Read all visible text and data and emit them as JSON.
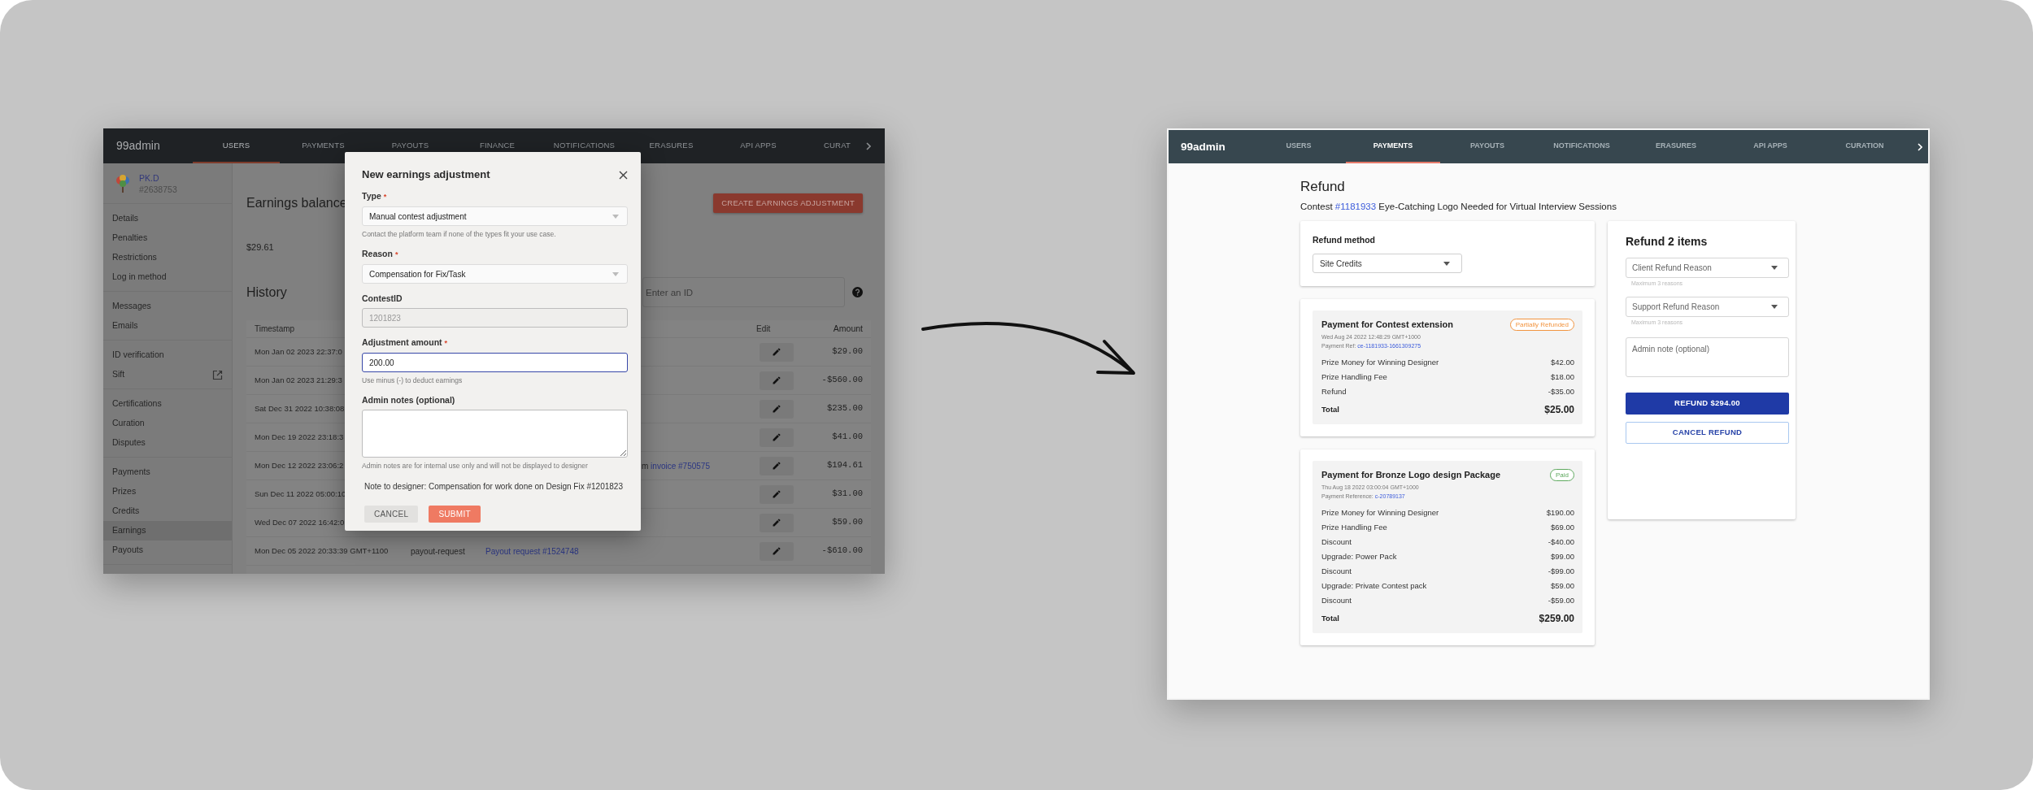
{
  "left_screen": {
    "navbar": {
      "brand": "99admin",
      "tabs": [
        {
          "label": "USERS",
          "selected": true
        },
        {
          "label": "PAYMENTS",
          "selected": false
        },
        {
          "label": "PAYOUTS",
          "selected": false
        },
        {
          "label": "FINANCE",
          "selected": false
        },
        {
          "label": "NOTIFICATIONS",
          "selected": false
        },
        {
          "label": "ERASURES",
          "selected": false
        },
        {
          "label": "API APPS",
          "selected": false
        },
        {
          "label": "CURAT",
          "selected": false
        }
      ]
    },
    "sidebar": {
      "user": {
        "name": "PK.D",
        "id": "#2638753"
      },
      "groups": [
        {
          "items": [
            {
              "label": "Details",
              "selected": false,
              "external": false
            },
            {
              "label": "Penalties",
              "selected": false,
              "external": false
            },
            {
              "label": "Restrictions",
              "selected": false,
              "external": false
            },
            {
              "label": "Log in method",
              "selected": false,
              "external": false
            }
          ]
        },
        {
          "items": [
            {
              "label": "Messages",
              "selected": false,
              "external": false
            },
            {
              "label": "Emails",
              "selected": false,
              "external": false
            }
          ]
        },
        {
          "items": [
            {
              "label": "ID verification",
              "selected": false,
              "external": false
            },
            {
              "label": "Sift",
              "selected": false,
              "external": true
            }
          ]
        },
        {
          "items": [
            {
              "label": "Certifications",
              "selected": false,
              "external": false
            },
            {
              "label": "Curation",
              "selected": false,
              "external": false
            },
            {
              "label": "Disputes",
              "selected": false,
              "external": false
            }
          ]
        },
        {
          "items": [
            {
              "label": "Payments",
              "selected": false,
              "external": false
            },
            {
              "label": "Prizes",
              "selected": false,
              "external": false
            },
            {
              "label": "Credits",
              "selected": false,
              "external": false
            },
            {
              "label": "Earnings",
              "selected": true,
              "external": false
            },
            {
              "label": "Payouts",
              "selected": false,
              "external": false
            }
          ]
        }
      ]
    },
    "main": {
      "title": "Earnings balance",
      "balance": "$29.61",
      "create_button": "CREATE EARNINGS ADJUSTMENT",
      "history_title": "History",
      "search": {
        "placeholder": "Enter an ID"
      },
      "table": {
        "columns": [
          "Timestamp",
          "Edit",
          "Amount"
        ],
        "rows": [
          {
            "timestamp": "Mon Jan 02 2023 22:37:0",
            "amount": "$29.00"
          },
          {
            "timestamp": "Mon Jan 02 2023 21:29:3",
            "amount": "-$560.00"
          },
          {
            "timestamp": "Sat Dec 31 2022 10:38:08",
            "amount": "$235.00"
          },
          {
            "timestamp": "Mon Dec 19 2022 23:18:3",
            "amount": "$41.00"
          },
          {
            "timestamp": "Mon Dec 12 2022 23:06:2",
            "description": {
              "text": "m",
              "link": "invoice #750575"
            },
            "amount": "$194.61"
          },
          {
            "timestamp": "Sun Dec 11 2022 05:00:10",
            "amount": "$31.00"
          },
          {
            "timestamp": "Wed Dec 07 2022 16:42:0",
            "amount": "$59.00"
          },
          {
            "timestamp": "Mon Dec 05 2022 20:33:39 GMT+1100",
            "type": "payout-request",
            "description": {
              "link": "Payout request #1524748"
            },
            "amount": "-$610.00"
          }
        ]
      }
    },
    "modal": {
      "title": "New earnings adjustment",
      "fields": [
        {
          "label": "Type",
          "marker": "*",
          "kind": "select",
          "value": "Manual contest adjustment",
          "hint": "Contact the platform team if none of the types fit your use case.",
          "disabled": false,
          "focused": false
        },
        {
          "label": "Reason",
          "marker": "*",
          "kind": "select",
          "value": "Compensation for Fix/Task",
          "disabled": false,
          "focused": false
        },
        {
          "label": "ContestID",
          "kind": "input",
          "value": "1201823",
          "disabled": true,
          "focused": false
        },
        {
          "label": "Adjustment amount",
          "marker": "*",
          "kind": "input",
          "value": "200.00",
          "hint": "Use minus (-) to deduct earnings",
          "disabled": false,
          "focused": true
        },
        {
          "label": "Admin notes (optional)",
          "kind": "textarea",
          "hint": "Admin notes are for internal use only and will not be displayed to designer",
          "disabled": false,
          "focused": false
        }
      ],
      "note": "Note to designer: Compensation for work done on Design Fix #1201823",
      "buttons": [
        {
          "label": "CANCEL",
          "kind": "secondary"
        },
        {
          "label": "SUBMIT",
          "kind": "primary"
        }
      ]
    }
  },
  "right_screen": {
    "navbar": {
      "brand": "99admin",
      "tabs": [
        {
          "label": "USERS",
          "selected": false
        },
        {
          "label": "PAYMENTS",
          "selected": true
        },
        {
          "label": "PAYOUTS",
          "selected": false
        },
        {
          "label": "NOTIFICATIONS",
          "selected": false
        },
        {
          "label": "ERASURES",
          "selected": false
        },
        {
          "label": "API APPS",
          "selected": false
        },
        {
          "label": "CURATION",
          "selected": false
        }
      ]
    },
    "title": "Refund",
    "contest": {
      "label": "Contest",
      "link": "#1181933",
      "name": "Eye-Catching Logo Needed for Virtual Interview Sessions"
    },
    "refund_method": {
      "label": "Refund method",
      "value": "Site Credits"
    },
    "payments": [
      {
        "title": "Payment for Contest extension",
        "status": "Partially Refunded",
        "color": "#f2943f",
        "date": "Wed Aug 24 2022 12:48:29 GMT+1000",
        "ref_label": "Payment Ref:",
        "ref_link": "ce-1181933-1661309275",
        "items": [
          {
            "label": "Prize Money for Winning Designer",
            "amount": "$42.00"
          },
          {
            "label": "Prize Handling Fee",
            "amount": "$18.00"
          },
          {
            "label": "Refund",
            "amount": "-$35.00"
          }
        ],
        "total_label": "Total",
        "total": "$25.00"
      },
      {
        "title": "Payment for Bronze Logo design Package",
        "status": "Paid",
        "color": "#5fa95f",
        "date": "Thu Aug 18 2022 03:00:04 GMT+1000",
        "ref_label": "Payment Reference:",
        "ref_link": "c-20789137",
        "items": [
          {
            "label": "Prize Money for Winning Designer",
            "amount": "$190.00"
          },
          {
            "label": "Prize Handling Fee",
            "amount": "$69.00"
          },
          {
            "label": "Discount",
            "amount": "-$40.00"
          },
          {
            "label": "Upgrade: Power Pack",
            "amount": "$99.00"
          },
          {
            "label": "Discount",
            "amount": "-$99.00"
          },
          {
            "label": "Upgrade: Private Contest pack",
            "amount": "$59.00"
          },
          {
            "label": "Discount",
            "amount": "-$59.00"
          }
        ],
        "total_label": "Total",
        "total": "$259.00"
      }
    ],
    "refund_panel": {
      "title": "Refund 2 items",
      "reasons": [
        {
          "placeholder": "Client Refund Reason",
          "hint": "Maximum 3 reasons"
        },
        {
          "placeholder": "Support Refund Reason",
          "hint": "Maximum 3 reasons"
        }
      ],
      "note": {
        "placeholder": "Admin note (optional)"
      },
      "refund_button": "REFUND $294.00",
      "cancel_button": "CANCEL REFUND"
    }
  }
}
